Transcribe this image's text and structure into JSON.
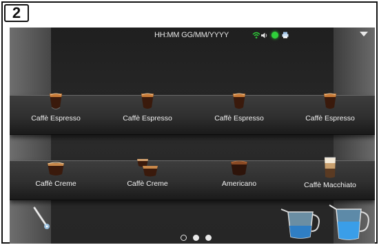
{
  "step_badge": "2",
  "status_bar": {
    "datetime": "HH:MM GG/MM/YYYY",
    "icons": [
      "wifi-icon",
      "speaker-icon",
      "status-led-icon",
      "printer-icon"
    ],
    "menu_icon": "chevron-down-icon",
    "status_led_color": "#2fd13a"
  },
  "beverages_row_1": [
    {
      "label": "Caffè Espresso",
      "icon": "espresso-cup-icon"
    },
    {
      "label": "Caffè Espresso",
      "icon": "espresso-cup-icon"
    },
    {
      "label": "Caffè Espresso",
      "icon": "espresso-cup-icon"
    },
    {
      "label": "Caffè Espresso",
      "icon": "espresso-cup-icon"
    }
  ],
  "beverages_row_2": [
    {
      "label": "Caffè Creme",
      "icon": "creme-cup-icon"
    },
    {
      "label": "Caffè Creme",
      "icon": "double-creme-cup-icon"
    },
    {
      "label": "Americano",
      "icon": "americano-cup-icon"
    },
    {
      "label": "Caffè Macchiato",
      "icon": "macchiato-glass-icon"
    }
  ],
  "bottom_icons": [
    "steam-wand-icon",
    "milk-jug-icon",
    "water-jug-icon"
  ],
  "pagination": {
    "pages": 3,
    "current": 1
  }
}
